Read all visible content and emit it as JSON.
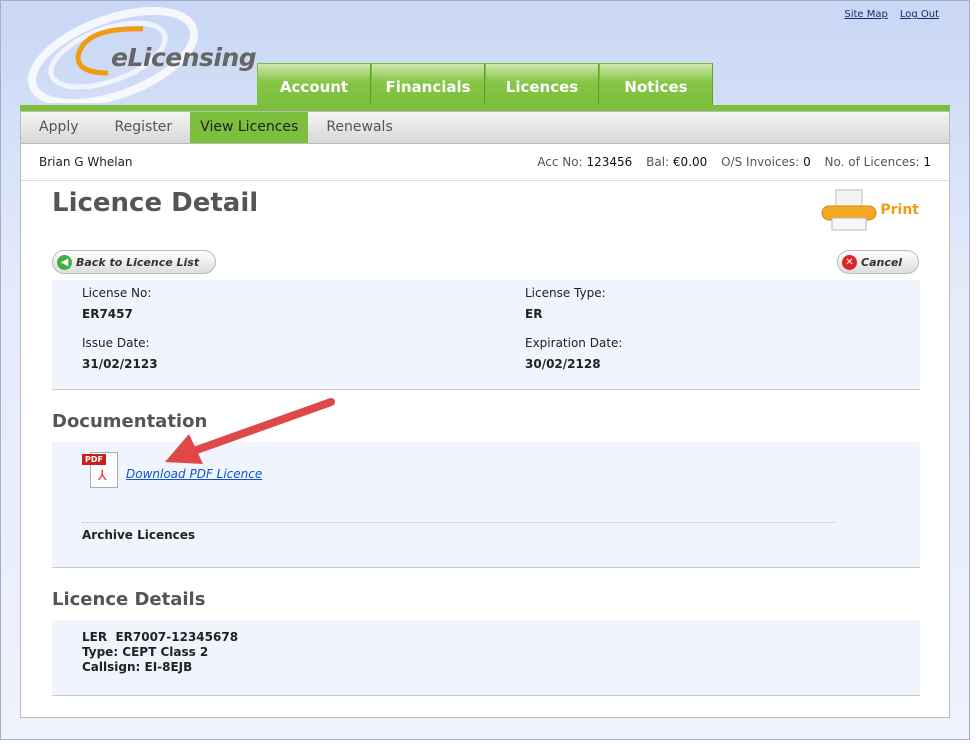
{
  "header": {
    "logo_text": "eLicensing",
    "site_map": "Site Map",
    "log_out": "Log Out"
  },
  "tabs": [
    "Account",
    "Financials",
    "Licences",
    "Notices"
  ],
  "subnav": [
    "Apply",
    "Register",
    "View Licences",
    "Renewals"
  ],
  "subnav_active": "View Licences",
  "account": {
    "name": "Brian G Whelan",
    "acc_label": "Acc No:",
    "acc_value": "123456",
    "bal_label": "Bal:",
    "bal_value": "€0.00",
    "invoices_label": "O/S Invoices:",
    "invoices_value": "0",
    "licences_label": "No. of Licences:",
    "licences_value": "1"
  },
  "page_title": "Licence Detail",
  "print_label": "Print",
  "back_button": "Back to Licence List",
  "cancel_button": "Cancel",
  "licence": {
    "no_label": "License No:",
    "no_value": "ER7457",
    "type_label": "License Type:",
    "type_value": "ER",
    "issue_label": "Issue Date:",
    "issue_value": "31/02/2123",
    "expiry_label": "Expiration Date:",
    "expiry_value": "30/02/2128"
  },
  "documentation": {
    "heading": "Documentation",
    "download_link": "Download PDF Licence",
    "pdf_icon_text": "PDF",
    "archive": "Archive Licences"
  },
  "details": {
    "heading": "Licence Details",
    "line1": "LER  ER7007-12345678",
    "line2": "Type: CEPT Class 2",
    "line3": "Callsign: EI-8EJB"
  },
  "colors": {
    "brand_green": "#7bbf3c",
    "print_orange": "#f29b12",
    "arrow_red": "#e04848"
  }
}
